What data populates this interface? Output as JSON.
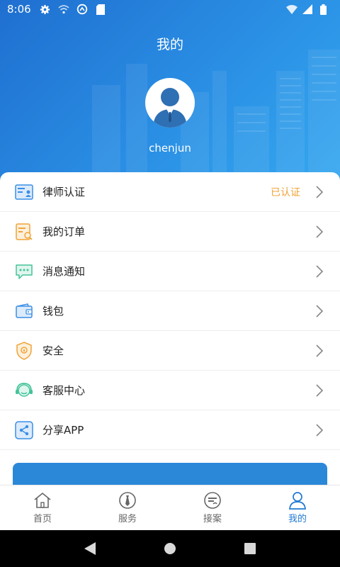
{
  "status_bar": {
    "time": "8:06",
    "icons_left": [
      "gear-icon",
      "wifi-off-icon",
      "sync-icon",
      "sd-card-icon"
    ],
    "icons_right": [
      "wifi-x-icon",
      "signal-icon",
      "battery-icon"
    ]
  },
  "header": {
    "title": "我的",
    "username": "chenjun",
    "background_color": "#2a8fe4"
  },
  "menu": {
    "items": [
      {
        "label": "律师认证",
        "status": "已认证",
        "icon": "id-card-icon",
        "icon_color": "#3a8ee6"
      },
      {
        "label": "我的订单",
        "icon": "order-search-icon",
        "icon_color": "#f0a43a"
      },
      {
        "label": "消息通知",
        "icon": "chat-bubble-icon",
        "icon_color": "#43c39a"
      },
      {
        "label": "钱包",
        "icon": "wallet-icon",
        "icon_color": "#3a8ee6"
      },
      {
        "label": "安全",
        "icon": "shield-icon",
        "icon_color": "#f0a43a"
      },
      {
        "label": "客服中心",
        "icon": "headset-icon",
        "icon_color": "#43c39a"
      },
      {
        "label": "分享APP",
        "icon": "share-icon",
        "icon_color": "#3a8ee6"
      }
    ],
    "status_color": "#f0a43a"
  },
  "tabbar": {
    "items": [
      {
        "label": "首页",
        "icon": "home-icon",
        "active": false
      },
      {
        "label": "服务",
        "icon": "tie-icon",
        "active": false
      },
      {
        "label": "接案",
        "icon": "case-icon",
        "active": false
      },
      {
        "label": "我的",
        "icon": "user-icon",
        "active": true
      }
    ],
    "active_color": "#1f79d2"
  },
  "nav_bar": {
    "buttons": [
      "back-icon",
      "home-circle-icon",
      "recents-icon"
    ]
  }
}
